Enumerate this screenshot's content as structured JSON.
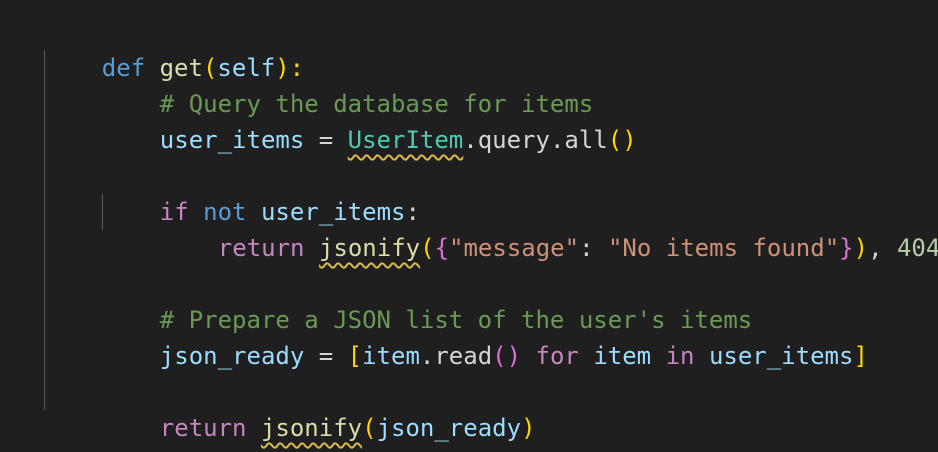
{
  "editor": {
    "lines": [
      {
        "tokens": [
          "def",
          " ",
          "get",
          "(",
          "self",
          "):"
        ]
      },
      {
        "tokens": [
          "# Query the database for items"
        ]
      },
      {
        "tokens": [
          "user_items",
          " = ",
          "UserItem",
          ".query.all",
          "()"
        ]
      },
      {
        "tokens": []
      },
      {
        "tokens": [
          "if",
          " ",
          "not",
          " ",
          "user_items",
          ":"
        ]
      },
      {
        "tokens": [
          "return",
          " ",
          "jsonify",
          "(",
          "{",
          "\"message\"",
          ": ",
          "\"No items found\"",
          "}",
          ")",
          ", ",
          "404"
        ]
      },
      {
        "tokens": []
      },
      {
        "tokens": [
          "# Prepare a JSON list of the user's items"
        ]
      },
      {
        "tokens": [
          "json_ready",
          " = ",
          "[",
          "item",
          ".read",
          "()",
          " ",
          "for",
          " ",
          "item",
          " ",
          "in",
          " ",
          "user_items",
          "]"
        ]
      },
      {
        "tokens": []
      },
      {
        "tokens": [
          "return",
          " ",
          "jsonify",
          "(",
          "json_ready",
          ")"
        ]
      }
    ]
  },
  "colors": {
    "background": "#1f1f1f",
    "keyword_def": "#569cd6",
    "keyword_control": "#c586c0",
    "function": "#dcdcaa",
    "variable": "#9cdcfe",
    "comment": "#6a9955",
    "string": "#ce9178",
    "number": "#b5cea8",
    "bracket_1": "#ffd700",
    "bracket_2": "#da70d6",
    "bracket_3": "#179fff",
    "warning_squiggle": "#d7ba4a"
  }
}
